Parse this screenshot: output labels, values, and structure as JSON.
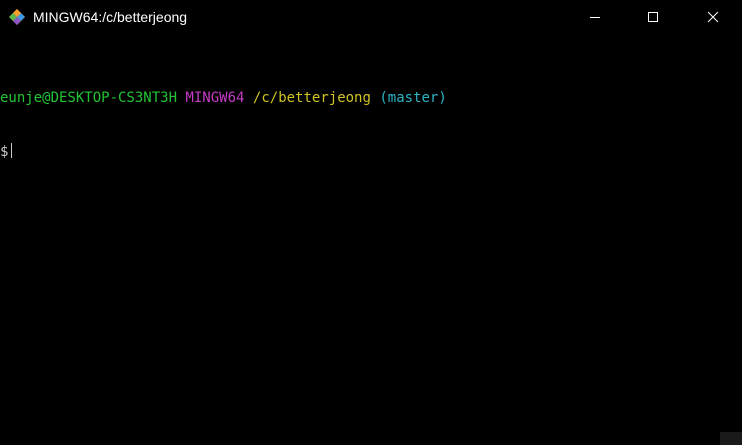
{
  "window": {
    "title": "MINGW64:/c/betterjeong",
    "icon": "git-bash-icon",
    "controls": {
      "minimize": "minimize-icon",
      "maximize": "maximize-icon",
      "close": "close-icon"
    }
  },
  "terminal": {
    "prompt": {
      "user_host": "eunje@DESKTOP-CS3NT3H",
      "system": "MINGW64",
      "path": "/c/betterjeong",
      "branch": "(master)",
      "symbol": "$"
    }
  },
  "colors": {
    "background": "#000000",
    "user_host": "#22c434",
    "system": "#c63cc7",
    "path": "#cfc422",
    "branch": "#2bb4c6",
    "text": "#cccccc"
  }
}
